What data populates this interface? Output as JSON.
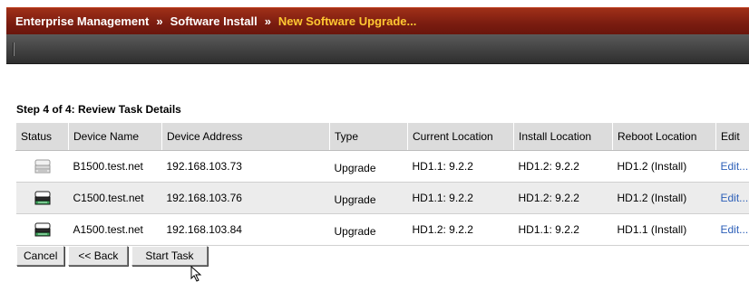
{
  "breadcrumb": {
    "items": [
      "Enterprise Management",
      "Software Install",
      "New Software Upgrade..."
    ],
    "separator": "»"
  },
  "step_title": "Step 4 of 4: Review Task Details",
  "table": {
    "headers": [
      "Status",
      "Device Name",
      "Device Address",
      "Type",
      "Current Location",
      "Install Location",
      "Reboot Location",
      "Edit"
    ],
    "rows": [
      {
        "status_icon": "server-icon-inactive",
        "device_name": "B1500.test.net",
        "device_address": "192.168.103.73",
        "type": "Upgrade",
        "current_location": "HD1.1: 9.2.2",
        "install_location": "HD1.2: 9.2.2",
        "reboot_location": "HD1.2 (Install)",
        "edit": "Edit..."
      },
      {
        "status_icon": "server-icon-active",
        "device_name": "C1500.test.net",
        "device_address": "192.168.103.76",
        "type": "Upgrade",
        "current_location": "HD1.1: 9.2.2",
        "install_location": "HD1.2: 9.2.2",
        "reboot_location": "HD1.2 (Install)",
        "edit": "Edit..."
      },
      {
        "status_icon": "server-icon-active",
        "device_name": "A1500.test.net",
        "device_address": "192.168.103.84",
        "type": "Upgrade",
        "current_location": "HD1.2: 9.2.2",
        "install_location": "HD1.1: 9.2.2",
        "reboot_location": "HD1.1 (Install)",
        "edit": "Edit..."
      }
    ]
  },
  "buttons": {
    "cancel": "Cancel",
    "back": "<< Back",
    "start": "Start Task"
  },
  "colors": {
    "breadcrumb_current": "#ffc832",
    "link": "#2c5fb8",
    "header_bar": "#7a1c10"
  }
}
